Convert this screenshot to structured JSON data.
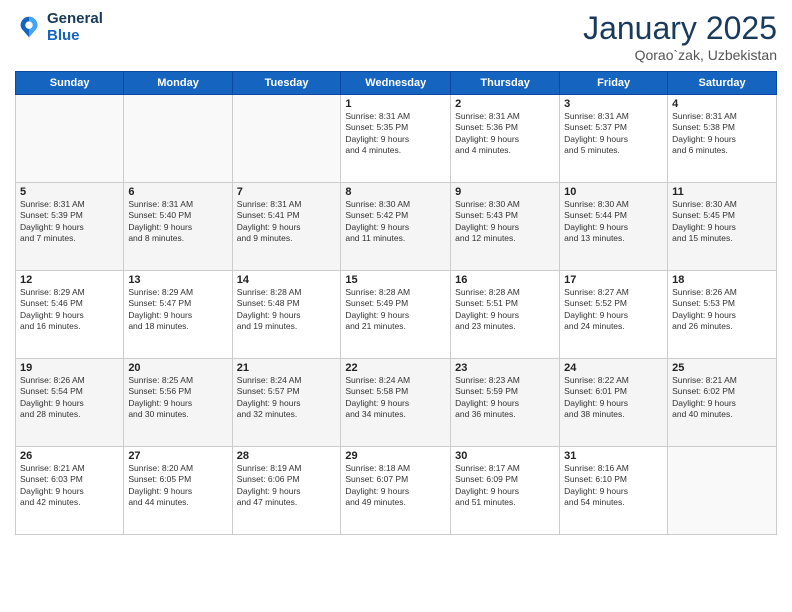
{
  "header": {
    "logo_line1": "General",
    "logo_line2": "Blue",
    "month": "January 2025",
    "location": "Qorao`zak, Uzbekistan"
  },
  "weekdays": [
    "Sunday",
    "Monday",
    "Tuesday",
    "Wednesday",
    "Thursday",
    "Friday",
    "Saturday"
  ],
  "weeks": [
    [
      {
        "day": "",
        "detail": ""
      },
      {
        "day": "",
        "detail": ""
      },
      {
        "day": "",
        "detail": ""
      },
      {
        "day": "1",
        "detail": "Sunrise: 8:31 AM\nSunset: 5:35 PM\nDaylight: 9 hours\nand 4 minutes."
      },
      {
        "day": "2",
        "detail": "Sunrise: 8:31 AM\nSunset: 5:36 PM\nDaylight: 9 hours\nand 4 minutes."
      },
      {
        "day": "3",
        "detail": "Sunrise: 8:31 AM\nSunset: 5:37 PM\nDaylight: 9 hours\nand 5 minutes."
      },
      {
        "day": "4",
        "detail": "Sunrise: 8:31 AM\nSunset: 5:38 PM\nDaylight: 9 hours\nand 6 minutes."
      }
    ],
    [
      {
        "day": "5",
        "detail": "Sunrise: 8:31 AM\nSunset: 5:39 PM\nDaylight: 9 hours\nand 7 minutes."
      },
      {
        "day": "6",
        "detail": "Sunrise: 8:31 AM\nSunset: 5:40 PM\nDaylight: 9 hours\nand 8 minutes."
      },
      {
        "day": "7",
        "detail": "Sunrise: 8:31 AM\nSunset: 5:41 PM\nDaylight: 9 hours\nand 9 minutes."
      },
      {
        "day": "8",
        "detail": "Sunrise: 8:30 AM\nSunset: 5:42 PM\nDaylight: 9 hours\nand 11 minutes."
      },
      {
        "day": "9",
        "detail": "Sunrise: 8:30 AM\nSunset: 5:43 PM\nDaylight: 9 hours\nand 12 minutes."
      },
      {
        "day": "10",
        "detail": "Sunrise: 8:30 AM\nSunset: 5:44 PM\nDaylight: 9 hours\nand 13 minutes."
      },
      {
        "day": "11",
        "detail": "Sunrise: 8:30 AM\nSunset: 5:45 PM\nDaylight: 9 hours\nand 15 minutes."
      }
    ],
    [
      {
        "day": "12",
        "detail": "Sunrise: 8:29 AM\nSunset: 5:46 PM\nDaylight: 9 hours\nand 16 minutes."
      },
      {
        "day": "13",
        "detail": "Sunrise: 8:29 AM\nSunset: 5:47 PM\nDaylight: 9 hours\nand 18 minutes."
      },
      {
        "day": "14",
        "detail": "Sunrise: 8:28 AM\nSunset: 5:48 PM\nDaylight: 9 hours\nand 19 minutes."
      },
      {
        "day": "15",
        "detail": "Sunrise: 8:28 AM\nSunset: 5:49 PM\nDaylight: 9 hours\nand 21 minutes."
      },
      {
        "day": "16",
        "detail": "Sunrise: 8:28 AM\nSunset: 5:51 PM\nDaylight: 9 hours\nand 23 minutes."
      },
      {
        "day": "17",
        "detail": "Sunrise: 8:27 AM\nSunset: 5:52 PM\nDaylight: 9 hours\nand 24 minutes."
      },
      {
        "day": "18",
        "detail": "Sunrise: 8:26 AM\nSunset: 5:53 PM\nDaylight: 9 hours\nand 26 minutes."
      }
    ],
    [
      {
        "day": "19",
        "detail": "Sunrise: 8:26 AM\nSunset: 5:54 PM\nDaylight: 9 hours\nand 28 minutes."
      },
      {
        "day": "20",
        "detail": "Sunrise: 8:25 AM\nSunset: 5:56 PM\nDaylight: 9 hours\nand 30 minutes."
      },
      {
        "day": "21",
        "detail": "Sunrise: 8:24 AM\nSunset: 5:57 PM\nDaylight: 9 hours\nand 32 minutes."
      },
      {
        "day": "22",
        "detail": "Sunrise: 8:24 AM\nSunset: 5:58 PM\nDaylight: 9 hours\nand 34 minutes."
      },
      {
        "day": "23",
        "detail": "Sunrise: 8:23 AM\nSunset: 5:59 PM\nDaylight: 9 hours\nand 36 minutes."
      },
      {
        "day": "24",
        "detail": "Sunrise: 8:22 AM\nSunset: 6:01 PM\nDaylight: 9 hours\nand 38 minutes."
      },
      {
        "day": "25",
        "detail": "Sunrise: 8:21 AM\nSunset: 6:02 PM\nDaylight: 9 hours\nand 40 minutes."
      }
    ],
    [
      {
        "day": "26",
        "detail": "Sunrise: 8:21 AM\nSunset: 6:03 PM\nDaylight: 9 hours\nand 42 minutes."
      },
      {
        "day": "27",
        "detail": "Sunrise: 8:20 AM\nSunset: 6:05 PM\nDaylight: 9 hours\nand 44 minutes."
      },
      {
        "day": "28",
        "detail": "Sunrise: 8:19 AM\nSunset: 6:06 PM\nDaylight: 9 hours\nand 47 minutes."
      },
      {
        "day": "29",
        "detail": "Sunrise: 8:18 AM\nSunset: 6:07 PM\nDaylight: 9 hours\nand 49 minutes."
      },
      {
        "day": "30",
        "detail": "Sunrise: 8:17 AM\nSunset: 6:09 PM\nDaylight: 9 hours\nand 51 minutes."
      },
      {
        "day": "31",
        "detail": "Sunrise: 8:16 AM\nSunset: 6:10 PM\nDaylight: 9 hours\nand 54 minutes."
      },
      {
        "day": "",
        "detail": ""
      }
    ]
  ]
}
